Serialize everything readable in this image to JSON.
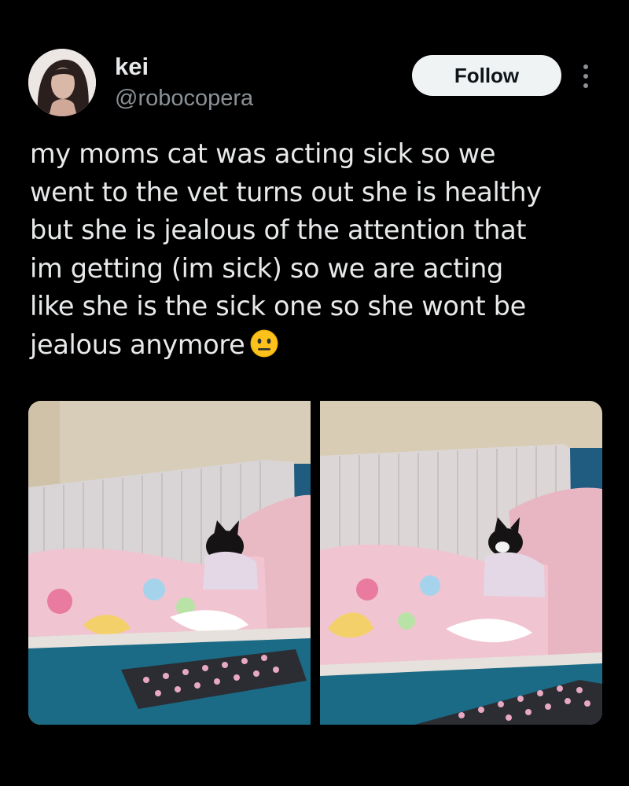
{
  "author": {
    "display_name": "kei",
    "handle": "@robocopera",
    "avatar_icon": "profile-photo"
  },
  "actions": {
    "follow_label": "Follow",
    "more_icon": "more-options-icon"
  },
  "tweet": {
    "lines": [
      "my moms cat was acting sick so we",
      "went to the vet turns out she is healthy",
      "but she is jealous of the attention that",
      "im getting (im sick) so we are acting",
      "like she is the sick one so she wont be",
      "jealous anymore"
    ],
    "emoji": "neutral-face-emoji"
  },
  "media": [
    {
      "kind": "photo",
      "subject": "cat-under-blanket"
    },
    {
      "kind": "photo",
      "subject": "cat-under-blanket"
    }
  ],
  "colors": {
    "background": "#000000",
    "text_primary": "#e7e9ea",
    "text_secondary": "#8b9196",
    "button_bg": "#eff3f4",
    "button_text": "#0f1419"
  }
}
